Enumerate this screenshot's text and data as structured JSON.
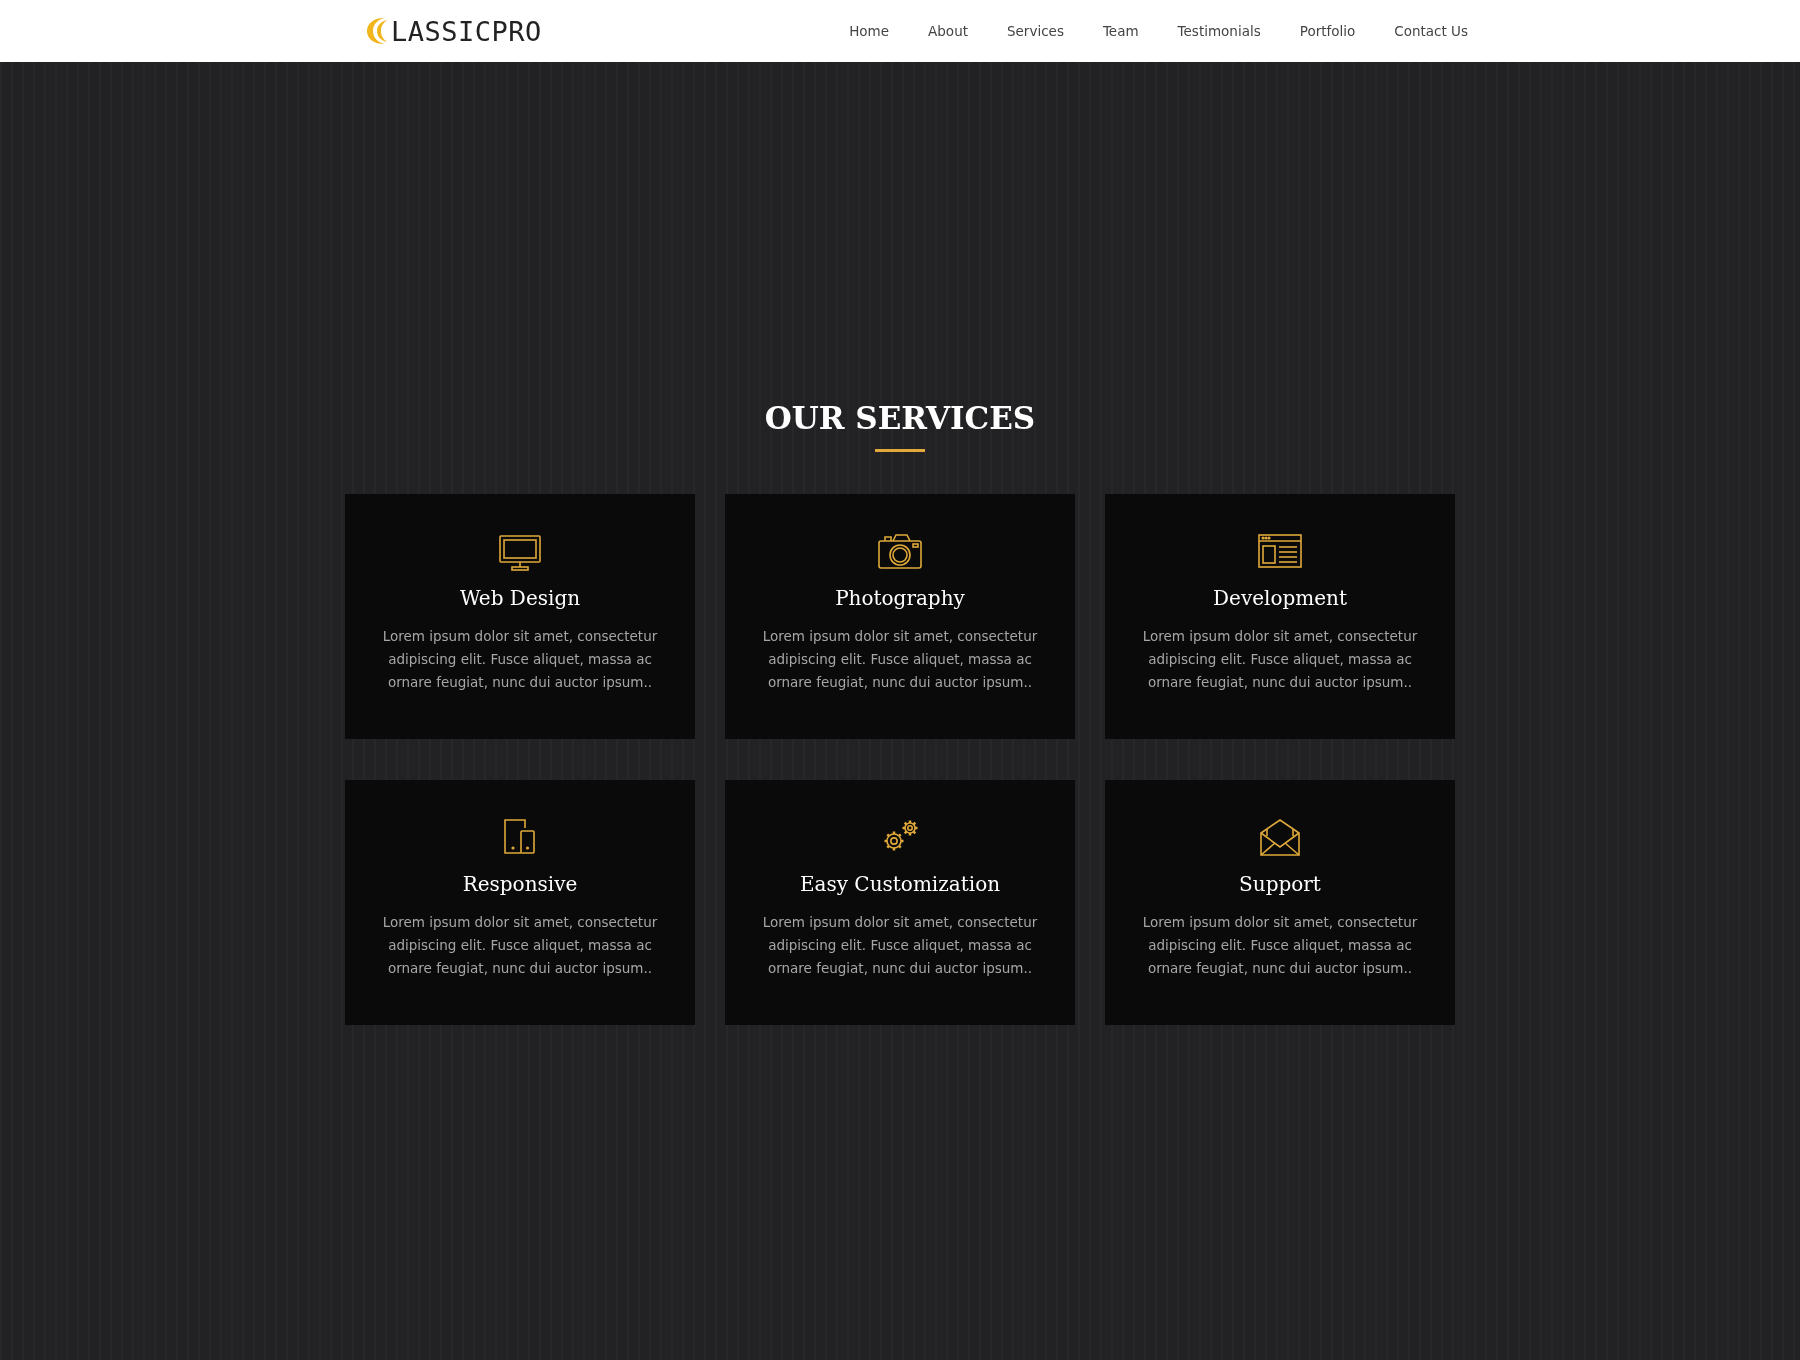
{
  "header": {
    "logo_text": "LASSICPRO",
    "nav": [
      {
        "label": "Home",
        "selected": false
      },
      {
        "label": "About",
        "selected": false
      },
      {
        "label": "Services",
        "selected": false
      },
      {
        "label": "Team",
        "selected": false
      },
      {
        "label": "Testimonials",
        "selected": false
      },
      {
        "label": "Portfolio",
        "selected": false
      },
      {
        "label": "Contact Us",
        "selected": false
      }
    ]
  },
  "services": {
    "title": "OUR SERVICES",
    "items": [
      {
        "kind": "monitor",
        "title": "Web Design",
        "text": "Lorem ipsum dolor sit amet, consectetur adipiscing elit. Fusce aliquet, massa ac ornare feugiat, nunc dui auctor ipsum.."
      },
      {
        "kind": "camera",
        "title": "Photography",
        "text": "Lorem ipsum dolor sit amet, consectetur adipiscing elit. Fusce aliquet, massa ac ornare feugiat, nunc dui auctor ipsum.."
      },
      {
        "kind": "browser",
        "title": "Development",
        "text": "Lorem ipsum dolor sit amet, consectetur adipiscing elit. Fusce aliquet, massa ac ornare feugiat, nunc dui auctor ipsum.."
      },
      {
        "kind": "devices",
        "title": "Responsive",
        "text": "Lorem ipsum dolor sit amet, consectetur adipiscing elit. Fusce aliquet, massa ac ornare feugiat, nunc dui auctor ipsum.."
      },
      {
        "kind": "gears",
        "title": "Easy Customization",
        "text": "Lorem ipsum dolor sit amet, consectetur adipiscing elit. Fusce aliquet, massa ac ornare feugiat, nunc dui auctor ipsum.."
      },
      {
        "kind": "envelope",
        "title": "Support",
        "text": "Lorem ipsum dolor sit amet, consectetur adipiscing elit. Fusce aliquet, massa ac ornare feugiat, nunc dui auctor ipsum.."
      }
    ]
  }
}
